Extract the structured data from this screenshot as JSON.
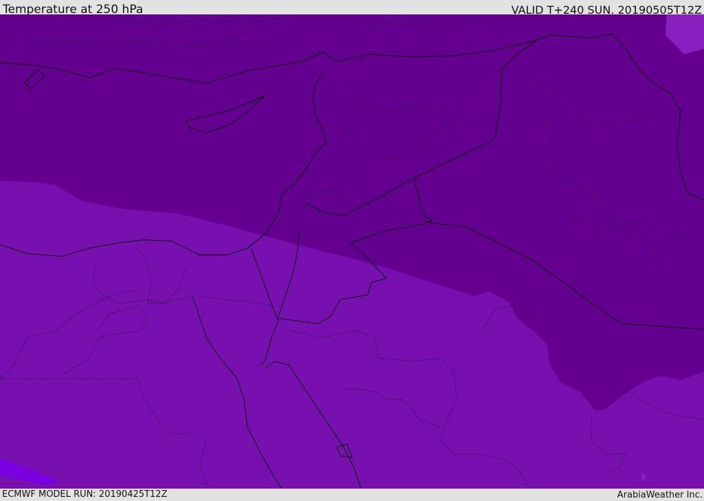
{
  "header": {
    "title": "Temperature at 250 hPa",
    "valid_time": "VALID T+240 SUN. 20190505T12Z"
  },
  "footer": {
    "model_run": "ECMWF MODEL RUN: 20190425T12Z",
    "brand": "ArabiaWeather Inc."
  },
  "map": {
    "variable": "temperature",
    "pressure_level": "250 hPa",
    "colors": {
      "cold_zone": "#64008f",
      "warm_zone": "#7710af",
      "small_zone": "#7a00e0",
      "lakes": "#8a1fc0",
      "borders": "#000000"
    }
  }
}
